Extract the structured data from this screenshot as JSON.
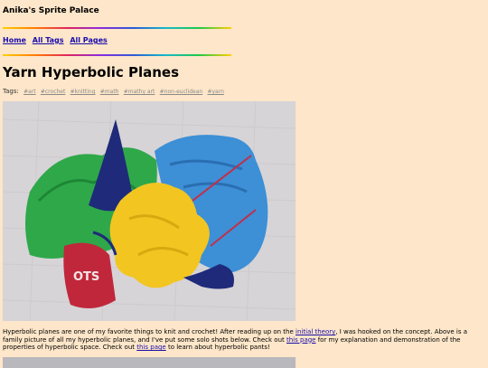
{
  "site": {
    "title": "Anika's Sprite Palace"
  },
  "nav": {
    "items": [
      "Home",
      "All Tags",
      "All Pages"
    ]
  },
  "post": {
    "title": "Yarn Hyperbolic Planes",
    "tags_label": "Tags:",
    "tags": [
      "#art",
      "#crochet",
      "#knitting",
      "#math",
      "#mathy art",
      "#non-euclidean",
      "#yarn"
    ],
    "paragraph": {
      "part1": "Hyperbolic planes are one of my favorite things to knit and crochet! After reading up on the ",
      "link1": "initial theory",
      "part2": ", I was hooked on the concept. Above is a family picture of all my hyperbolic planes, and I've put some solo shots below. Check out ",
      "link2": "this page",
      "part3": " for my explanation and demonstration of the properties of hyperbolic space. Check out ",
      "link3": "this page",
      "part4": " to learn about hyperbolic pants!"
    },
    "photo_label": "OTS"
  },
  "colors": {
    "background": "#fde6c9",
    "link": "#1a0dab",
    "tag": "#8a8a8a"
  }
}
